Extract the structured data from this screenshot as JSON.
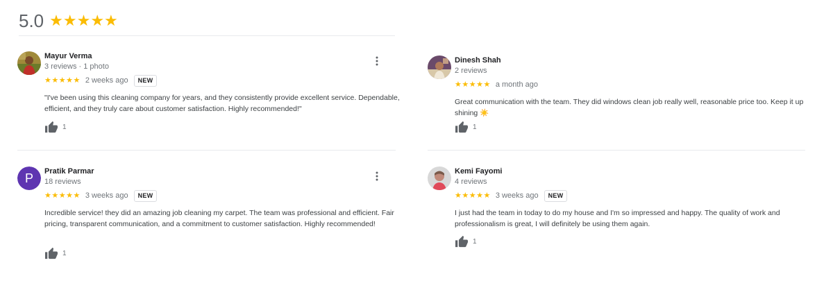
{
  "summary": {
    "rating": "5.0",
    "stars": "★★★★★"
  },
  "reviews": [
    {
      "name": "Mayur Verma",
      "meta": "3 reviews · 1 photo",
      "stars": "★★★★★",
      "time": "2 weeks ago",
      "badge": "NEW",
      "text": "\"I've been using this cleaning company for years, and they consistently provide excellent service. Dependable, efficient, and they truly care about customer satisfaction. Highly recommended!\"",
      "likes": "1"
    },
    {
      "name": "Dinesh Shah",
      "meta": "2 reviews",
      "stars": "★★★★★",
      "time": "a month ago",
      "badge": "",
      "text": "Great communication with the team. They did windows clean job really well, reasonable price too. Keep it up shining ☀️",
      "likes": "1"
    },
    {
      "name": "Pratik Parmar",
      "meta": "18 reviews",
      "avatar_letter": "P",
      "stars": "★★★★★",
      "time": "3 weeks ago",
      "badge": "NEW",
      "text": "Incredible service! they did an amazing job cleaning my carpet. The team was professional and efficient. Fair pricing, transparent communication, and a commitment to customer satisfaction. Highly recommended!",
      "likes": "1"
    },
    {
      "name": "Kemi Fayomi",
      "meta": "4 reviews",
      "stars": "★★★★★",
      "time": "3 weeks ago",
      "badge": "NEW",
      "text": "I just had the team in today to do my house and I'm so impressed and happy. The quality of work and professionalism is great, I will definitely be using them again.",
      "likes": "1"
    }
  ],
  "colors": {
    "star": "#fbbc04",
    "avatar_letter_bg": "#5e35b1",
    "muted_text": "#70757a"
  }
}
